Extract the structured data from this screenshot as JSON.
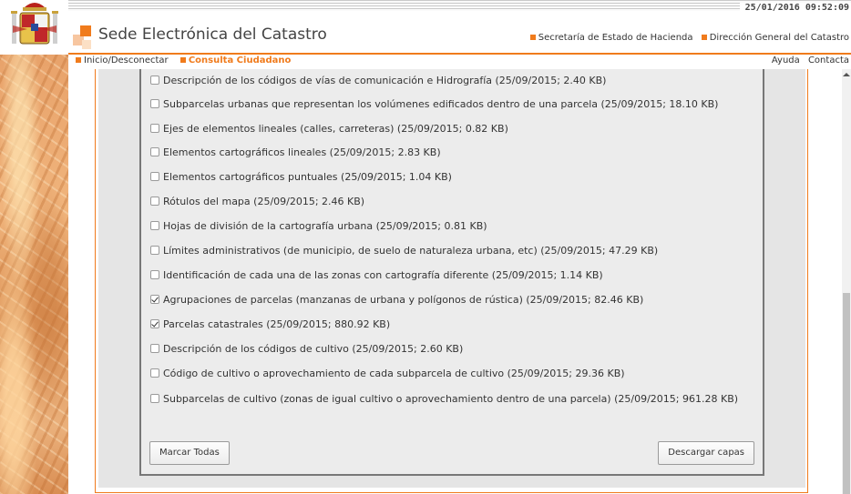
{
  "header": {
    "datetime": "25/01/2016 09:52:09",
    "site_title": "Sede Electrónica del Catastro",
    "links": [
      "Secretaría de Estado de Hacienda",
      "Dirección General del Catastro"
    ]
  },
  "nav": {
    "left": [
      "Inicio/Desconectar",
      "Consulta Ciudadano"
    ],
    "right": [
      "Ayuda",
      "Contacta"
    ]
  },
  "layers": [
    {
      "label": "Descripción de los códigos de vías de comunicación e Hidrografía (25/09/2015; 2.40 KB)",
      "checked": false
    },
    {
      "label": "Subparcelas urbanas que representan los volúmenes edificados dentro de una parcela (25/09/2015; 18.10 KB)",
      "checked": false
    },
    {
      "label": "Ejes de elementos lineales (calles, carreteras) (25/09/2015; 0.82 KB)",
      "checked": false
    },
    {
      "label": "Elementos cartográficos lineales (25/09/2015; 2.83 KB)",
      "checked": false
    },
    {
      "label": "Elementos cartográficos puntuales (25/09/2015; 1.04 KB)",
      "checked": false
    },
    {
      "label": "Rótulos del mapa (25/09/2015; 2.46 KB)",
      "checked": false
    },
    {
      "label": "Hojas de división de la cartografía urbana (25/09/2015; 0.81 KB)",
      "checked": false
    },
    {
      "label": "Límites administrativos (de municipio, de suelo de naturaleza urbana, etc) (25/09/2015; 47.29 KB)",
      "checked": false
    },
    {
      "label": "Identificación de cada una de las zonas con cartografía diferente (25/09/2015; 1.14 KB)",
      "checked": false
    },
    {
      "label": "Agrupaciones de parcelas (manzanas de urbana y polígonos de rústica) (25/09/2015; 82.46 KB)",
      "checked": true
    },
    {
      "label": "Parcelas catastrales (25/09/2015; 880.92 KB)",
      "checked": true
    },
    {
      "label": "Descripción de los códigos de cultivo (25/09/2015; 2.60 KB)",
      "checked": false
    },
    {
      "label": "Código de cultivo o aprovechamiento de cada subparcela de cultivo (25/09/2015; 29.36 KB)",
      "checked": false
    },
    {
      "label": "Subparcelas de cultivo (zonas de igual cultivo o aprovechamiento dentro de una parcela) (25/09/2015; 961.28 KB)",
      "checked": false
    }
  ],
  "buttons": {
    "select_all": "Marcar Todas",
    "download": "Descargar capas"
  },
  "colors": {
    "accent": "#f07b1c"
  }
}
